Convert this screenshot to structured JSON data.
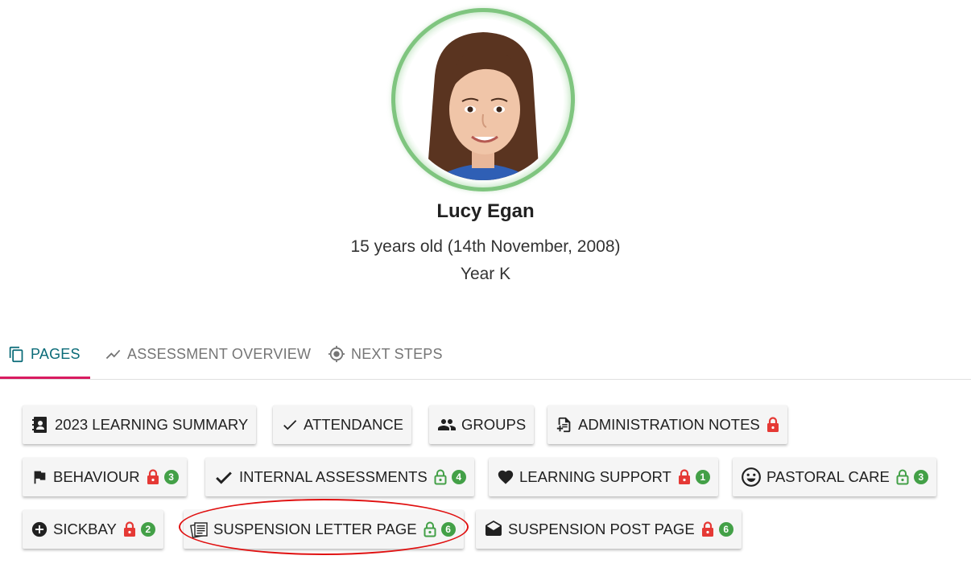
{
  "student": {
    "name": "Lucy Egan",
    "age_line": "15 years old (14th November, 2008)",
    "year": "Year K"
  },
  "tabs": [
    {
      "label": "PAGES",
      "icon": "copy-pages-icon",
      "active": true
    },
    {
      "label": "ASSESSMENT OVERVIEW",
      "icon": "trend-line-icon",
      "active": false
    },
    {
      "label": "NEXT STEPS",
      "icon": "crosshair-icon",
      "active": false
    }
  ],
  "pages": [
    {
      "label": "2023 LEARNING SUMMARY",
      "icon": "contact-book-icon"
    },
    {
      "label": "ATTENDANCE",
      "icon": "check-icon"
    },
    {
      "label": "GROUPS",
      "icon": "people-icon"
    },
    {
      "label": "ADMINISTRATION NOTES",
      "icon": "note-add-icon",
      "lock": "locked"
    },
    {
      "label": "BEHAVIOUR",
      "icon": "flag-icon",
      "lock": "locked",
      "count": "3"
    },
    {
      "label": "INTERNAL ASSESSMENTS",
      "icon": "bold-check-icon",
      "lock": "unlocked",
      "count": "4"
    },
    {
      "label": "LEARNING SUPPORT",
      "icon": "heart-icon",
      "lock": "locked",
      "count": "1"
    },
    {
      "label": "PASTORAL CARE",
      "icon": "smiley-icon",
      "lock": "unlocked",
      "count": "3"
    },
    {
      "label": "SICKBAY",
      "icon": "plus-circle-icon",
      "lock": "locked",
      "count": "2"
    },
    {
      "label": "SUSPENSION LETTER PAGE",
      "icon": "letter-stack-icon",
      "lock": "unlocked",
      "count": "6"
    },
    {
      "label": "SUSPENSION POST PAGE",
      "icon": "open-envelope-icon",
      "lock": "locked",
      "count": "6"
    }
  ],
  "colors": {
    "active_tab": "#0a6b78",
    "tab_underline": "#d81b60",
    "locked": "#e53935",
    "unlocked": "#43a047",
    "count_badge": "#43a047",
    "avatar_ring": "#7fc57f",
    "annotation_ellipse": "#e01010"
  }
}
